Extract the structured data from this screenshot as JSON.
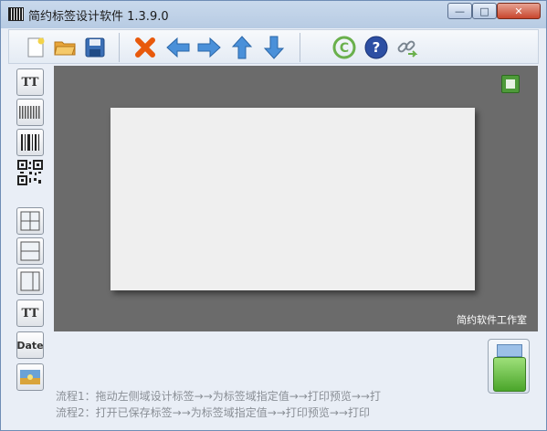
{
  "window": {
    "title": "简约标签设计软件  1.3.9.0",
    "controls": {
      "minimize": "—",
      "maximize": "□",
      "close": "✕"
    }
  },
  "toolbar": {
    "items": [
      {
        "name": "new-file-icon",
        "color": "#ffffff"
      },
      {
        "name": "open-folder-icon",
        "color": "#e6a23c"
      },
      {
        "name": "save-icon",
        "color": "#3b6fb5"
      },
      {
        "name": "delete-icon",
        "color": "#e8590c"
      },
      {
        "name": "arrow-left-icon",
        "color": "#4a90d9"
      },
      {
        "name": "arrow-right-icon",
        "color": "#4a90d9"
      },
      {
        "name": "arrow-up-icon",
        "color": "#4a90d9"
      },
      {
        "name": "arrow-down-icon",
        "color": "#4a90d9"
      },
      {
        "name": "copyright-icon",
        "color": "#6ab04c"
      },
      {
        "name": "help-icon",
        "color": "#2d4fa3"
      },
      {
        "name": "link-icon",
        "color": "#6ab04c"
      }
    ]
  },
  "sidebar": {
    "items": [
      {
        "name": "text-tool",
        "label": "TT"
      },
      {
        "name": "barcode-strip-tool",
        "label": ""
      },
      {
        "name": "barcode-tool",
        "label": ""
      },
      {
        "name": "qrcode-tool",
        "label": ""
      },
      {
        "name": "grid-four-tool",
        "label": ""
      },
      {
        "name": "grid-two-row-tool",
        "label": ""
      },
      {
        "name": "split-column-tool",
        "label": ""
      },
      {
        "name": "text-field-tool",
        "label": "TT"
      },
      {
        "name": "date-tool",
        "label": "Date"
      },
      {
        "name": "image-tool",
        "label": ""
      }
    ]
  },
  "canvas": {
    "studio": "简约软件工作室"
  },
  "flow": {
    "line1": "流程1：拖动左侧域设计标签→→为标签域指定值→→打印预览→→打",
    "line2": "流程2：打开已保存标签→→为标签域指定值→→打印预览→→打印"
  }
}
